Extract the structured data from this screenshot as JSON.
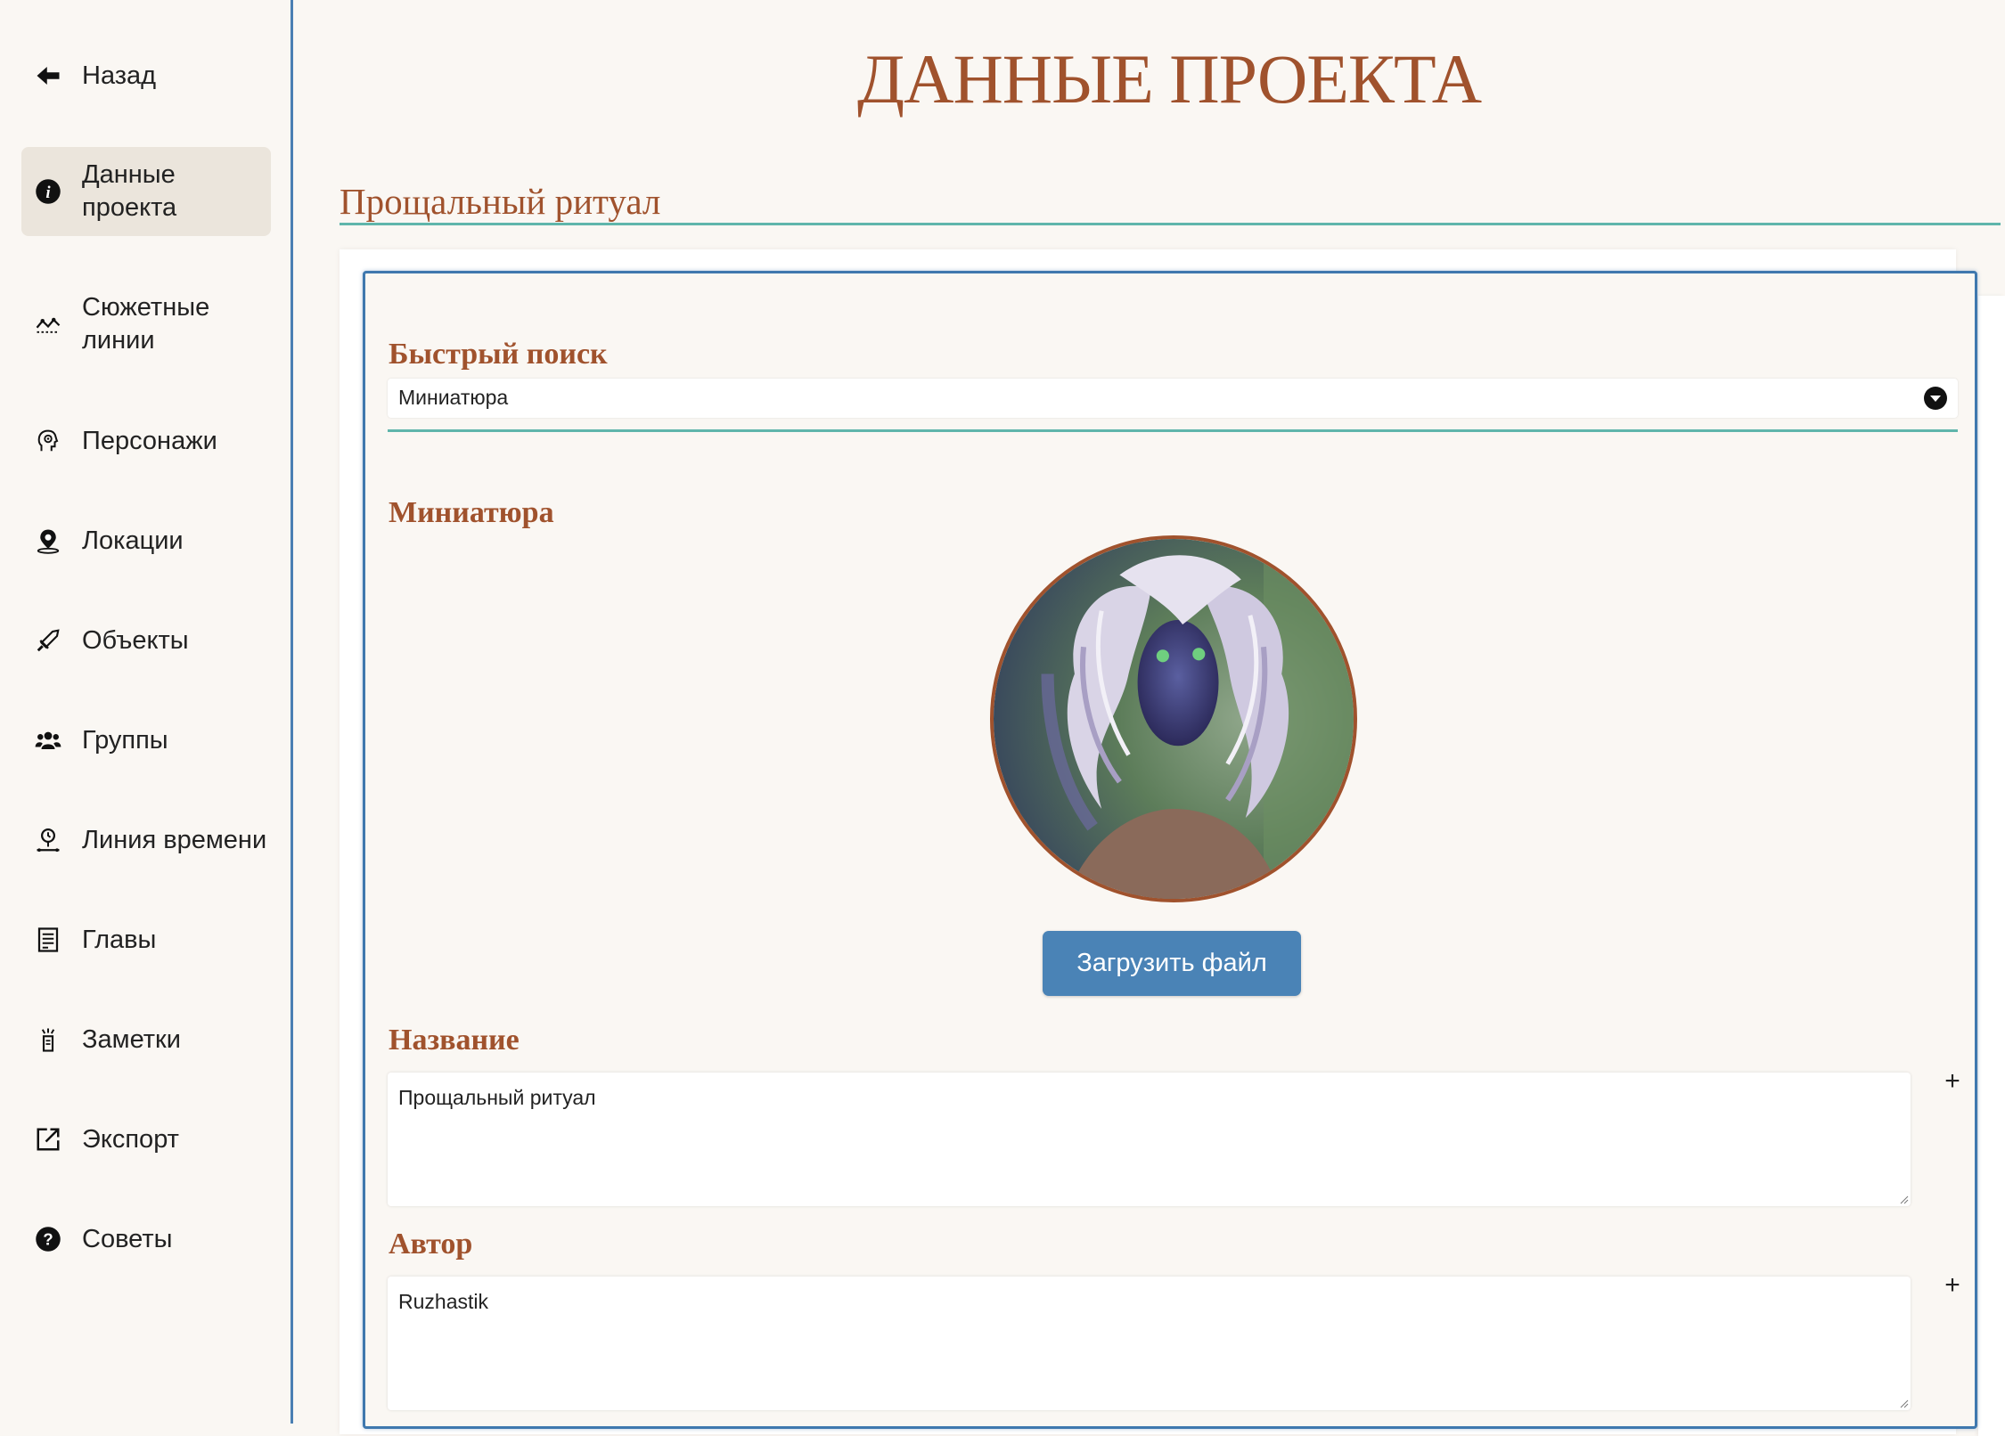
{
  "sidebar": {
    "items": [
      {
        "label": "Назад",
        "icon": "back-arrow-icon"
      },
      {
        "label": "Данные проекта",
        "icon": "info-icon",
        "active": true
      },
      {
        "label": "Сюжетные линии",
        "icon": "plotline-icon"
      },
      {
        "label": "Персонажи",
        "icon": "head-gear-icon"
      },
      {
        "label": "Локации",
        "icon": "map-pin-icon"
      },
      {
        "label": "Объекты",
        "icon": "sword-icon"
      },
      {
        "label": "Группы",
        "icon": "users-icon"
      },
      {
        "label": "Линия времени",
        "icon": "timeline-icon"
      },
      {
        "label": "Главы",
        "icon": "document-icon"
      },
      {
        "label": "Заметки",
        "icon": "notes-icon"
      },
      {
        "label": "Экспорт",
        "icon": "export-icon"
      },
      {
        "label": "Советы",
        "icon": "help-icon"
      }
    ]
  },
  "header": {
    "title": "ДАННЫЕ ПРОЕКТА",
    "project_name": "Прощальный ритуал"
  },
  "form": {
    "quick_search_label": "Быстрый поиск",
    "quick_search_value": "Миниатюра",
    "thumbnail_label": "Миниатюра",
    "upload_button": "Загрузить файл",
    "title_label": "Название",
    "title_value": "Прощальный ритуал",
    "author_label": "Автор",
    "author_value": "Ruzhastik",
    "add_symbol": "+"
  },
  "colors": {
    "accent": "#a0522d",
    "primary_button": "#4a83b6",
    "underline": "#5fb5ab",
    "border": "#3f78ae"
  }
}
